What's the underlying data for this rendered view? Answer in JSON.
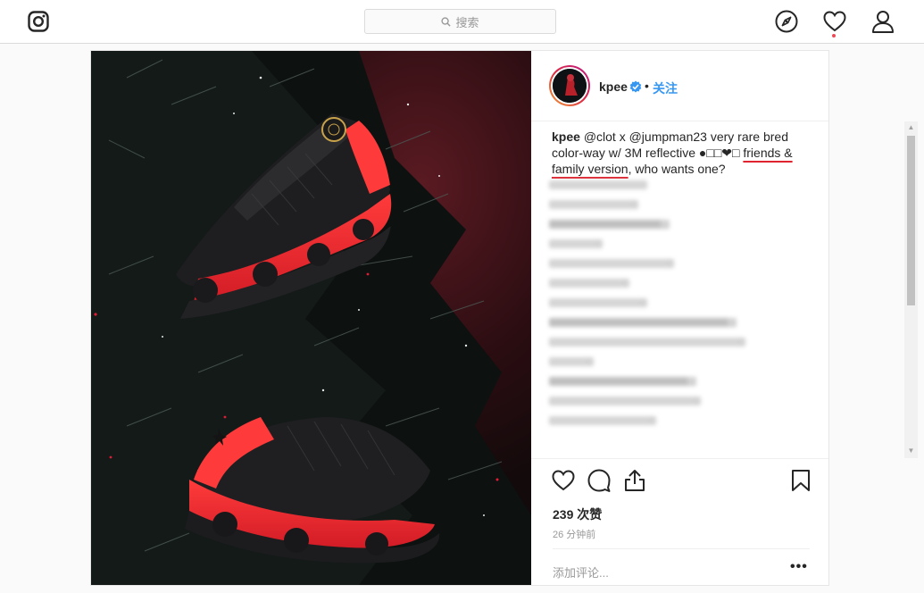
{
  "header": {
    "search_placeholder": "搜索"
  },
  "post": {
    "username": "kpee",
    "follow_label": "关注",
    "separator": "•",
    "caption": {
      "username": "kpee",
      "text_before": "@clot x @jumpman23 very rare bred color-way w/ 3M reflective ●□□❤□ ",
      "underlined": "friends & family version",
      "text_after": ", who wants one?"
    },
    "likes": "239 次赞",
    "timestamp": "26 分钟前",
    "add_comment_placeholder": "添加评论...",
    "more_label": "•••"
  },
  "colors": {
    "accent": "#3897f0",
    "underline": "#e0242f",
    "notification": "#ed4956"
  },
  "icons": {
    "logo": "instagram-icon",
    "explore": "compass-icon",
    "activity": "heart-icon",
    "profile": "user-icon",
    "like": "heart-outline-icon",
    "comment": "comment-icon",
    "share": "share-icon",
    "save": "bookmark-icon"
  }
}
